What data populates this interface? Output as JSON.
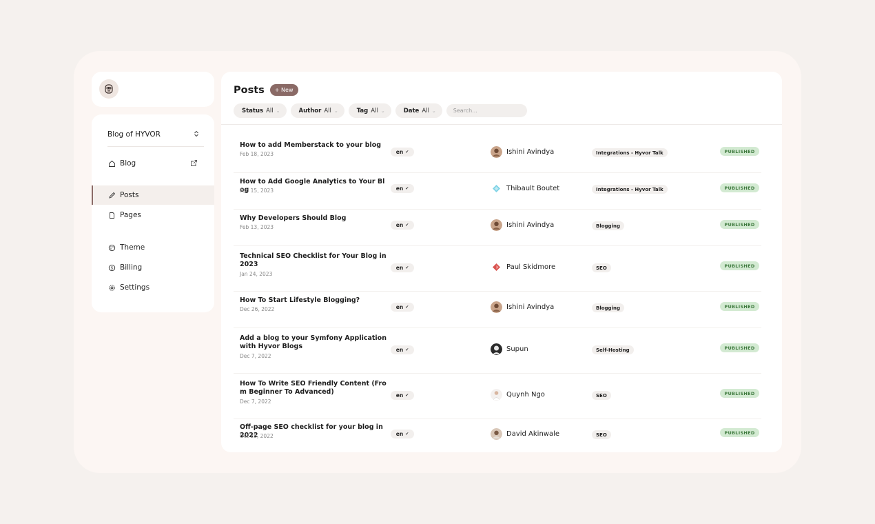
{
  "sidebar": {
    "blog_name": "Blog of HYVOR",
    "items": [
      {
        "label": "Blog"
      },
      {
        "label": "Posts"
      },
      {
        "label": "Pages"
      },
      {
        "label": "Theme"
      },
      {
        "label": "Billing"
      },
      {
        "label": "Settings"
      }
    ]
  },
  "header": {
    "title": "Posts",
    "new_button": "+ New",
    "filters": [
      {
        "label": "Status",
        "value": "All"
      },
      {
        "label": "Author",
        "value": "All"
      },
      {
        "label": "Tag",
        "value": "All"
      },
      {
        "label": "Date",
        "value": "All"
      }
    ],
    "search_placeholder": "Search..."
  },
  "posts": [
    {
      "title": "How to add Memberstack to your blog",
      "date": "Feb 18, 2023",
      "lang": "en",
      "author": "Ishini Avindya",
      "tag": "Integrations - Hyvor Talk",
      "status": "PUBLISHED"
    },
    {
      "title": "How to Add Google Analytics to Your Blog",
      "date": "Feb 15, 2023",
      "lang": "en",
      "author": "Thibault Boutet",
      "tag": "Integrations - Hyvor Talk",
      "status": "PUBLISHED"
    },
    {
      "title": "Why Developers Should Blog",
      "date": "Feb 13, 2023",
      "lang": "en",
      "author": "Ishini Avindya",
      "tag": "Blogging",
      "status": "PUBLISHED"
    },
    {
      "title": "Technical SEO Checklist for Your Blog in 2023",
      "date": "Jan 24, 2023",
      "lang": "en",
      "author": "Paul Skidmore",
      "tag": "SEO",
      "status": "PUBLISHED"
    },
    {
      "title": "How To Start Lifestyle Blogging?",
      "date": "Dec 26, 2022",
      "lang": "en",
      "author": "Ishini Avindya",
      "tag": "Blogging",
      "status": "PUBLISHED"
    },
    {
      "title": "Add a blog to your Symfony Application with Hyvor Blogs",
      "date": "Dec 7, 2022",
      "lang": "en",
      "author": "Supun",
      "tag": "Self-Hosting",
      "status": "PUBLISHED"
    },
    {
      "title": "How To Write SEO Friendly Content (From Beginner To Advanced)",
      "date": "Dec 7, 2022",
      "lang": "en",
      "author": "Quynh Ngo",
      "tag": "SEO",
      "status": "PUBLISHED"
    },
    {
      "title": "Off-page SEO checklist for your blog in 2022",
      "date": "Oct 28, 2022",
      "lang": "en",
      "author": "David Akinwale",
      "tag": "SEO",
      "status": "PUBLISHED"
    }
  ],
  "colors": {
    "accent": "#8a6a66",
    "published_bg": "#d3ead2",
    "published_text": "#3e7a3e",
    "background": "#f5f1ee"
  }
}
